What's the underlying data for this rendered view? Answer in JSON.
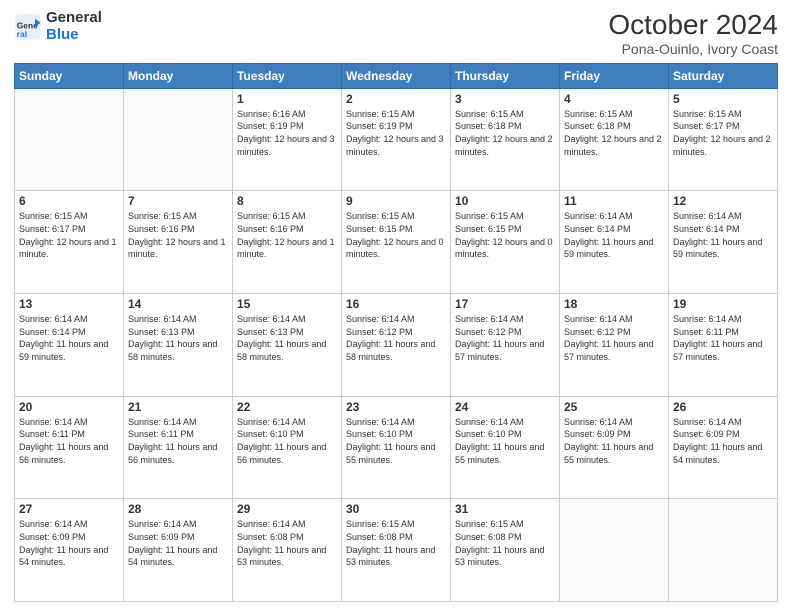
{
  "header": {
    "logo_line1": "General",
    "logo_line2": "Blue",
    "title": "October 2024",
    "subtitle": "Pona-Ouinlo, Ivory Coast"
  },
  "columns": [
    "Sunday",
    "Monday",
    "Tuesday",
    "Wednesday",
    "Thursday",
    "Friday",
    "Saturday"
  ],
  "weeks": [
    [
      {
        "day": "",
        "info": ""
      },
      {
        "day": "",
        "info": ""
      },
      {
        "day": "1",
        "info": "Sunrise: 6:16 AM\nSunset: 6:19 PM\nDaylight: 12 hours and 3 minutes."
      },
      {
        "day": "2",
        "info": "Sunrise: 6:15 AM\nSunset: 6:19 PM\nDaylight: 12 hours and 3 minutes."
      },
      {
        "day": "3",
        "info": "Sunrise: 6:15 AM\nSunset: 6:18 PM\nDaylight: 12 hours and 2 minutes."
      },
      {
        "day": "4",
        "info": "Sunrise: 6:15 AM\nSunset: 6:18 PM\nDaylight: 12 hours and 2 minutes."
      },
      {
        "day": "5",
        "info": "Sunrise: 6:15 AM\nSunset: 6:17 PM\nDaylight: 12 hours and 2 minutes."
      }
    ],
    [
      {
        "day": "6",
        "info": "Sunrise: 6:15 AM\nSunset: 6:17 PM\nDaylight: 12 hours and 1 minute."
      },
      {
        "day": "7",
        "info": "Sunrise: 6:15 AM\nSunset: 6:16 PM\nDaylight: 12 hours and 1 minute."
      },
      {
        "day": "8",
        "info": "Sunrise: 6:15 AM\nSunset: 6:16 PM\nDaylight: 12 hours and 1 minute."
      },
      {
        "day": "9",
        "info": "Sunrise: 6:15 AM\nSunset: 6:15 PM\nDaylight: 12 hours and 0 minutes."
      },
      {
        "day": "10",
        "info": "Sunrise: 6:15 AM\nSunset: 6:15 PM\nDaylight: 12 hours and 0 minutes."
      },
      {
        "day": "11",
        "info": "Sunrise: 6:14 AM\nSunset: 6:14 PM\nDaylight: 11 hours and 59 minutes."
      },
      {
        "day": "12",
        "info": "Sunrise: 6:14 AM\nSunset: 6:14 PM\nDaylight: 11 hours and 59 minutes."
      }
    ],
    [
      {
        "day": "13",
        "info": "Sunrise: 6:14 AM\nSunset: 6:14 PM\nDaylight: 11 hours and 59 minutes."
      },
      {
        "day": "14",
        "info": "Sunrise: 6:14 AM\nSunset: 6:13 PM\nDaylight: 11 hours and 58 minutes."
      },
      {
        "day": "15",
        "info": "Sunrise: 6:14 AM\nSunset: 6:13 PM\nDaylight: 11 hours and 58 minutes."
      },
      {
        "day": "16",
        "info": "Sunrise: 6:14 AM\nSunset: 6:12 PM\nDaylight: 11 hours and 58 minutes."
      },
      {
        "day": "17",
        "info": "Sunrise: 6:14 AM\nSunset: 6:12 PM\nDaylight: 11 hours and 57 minutes."
      },
      {
        "day": "18",
        "info": "Sunrise: 6:14 AM\nSunset: 6:12 PM\nDaylight: 11 hours and 57 minutes."
      },
      {
        "day": "19",
        "info": "Sunrise: 6:14 AM\nSunset: 6:11 PM\nDaylight: 11 hours and 57 minutes."
      }
    ],
    [
      {
        "day": "20",
        "info": "Sunrise: 6:14 AM\nSunset: 6:11 PM\nDaylight: 11 hours and 56 minutes."
      },
      {
        "day": "21",
        "info": "Sunrise: 6:14 AM\nSunset: 6:11 PM\nDaylight: 11 hours and 56 minutes."
      },
      {
        "day": "22",
        "info": "Sunrise: 6:14 AM\nSunset: 6:10 PM\nDaylight: 11 hours and 56 minutes."
      },
      {
        "day": "23",
        "info": "Sunrise: 6:14 AM\nSunset: 6:10 PM\nDaylight: 11 hours and 55 minutes."
      },
      {
        "day": "24",
        "info": "Sunrise: 6:14 AM\nSunset: 6:10 PM\nDaylight: 11 hours and 55 minutes."
      },
      {
        "day": "25",
        "info": "Sunrise: 6:14 AM\nSunset: 6:09 PM\nDaylight: 11 hours and 55 minutes."
      },
      {
        "day": "26",
        "info": "Sunrise: 6:14 AM\nSunset: 6:09 PM\nDaylight: 11 hours and 54 minutes."
      }
    ],
    [
      {
        "day": "27",
        "info": "Sunrise: 6:14 AM\nSunset: 6:09 PM\nDaylight: 11 hours and 54 minutes."
      },
      {
        "day": "28",
        "info": "Sunrise: 6:14 AM\nSunset: 6:09 PM\nDaylight: 11 hours and 54 minutes."
      },
      {
        "day": "29",
        "info": "Sunrise: 6:14 AM\nSunset: 6:08 PM\nDaylight: 11 hours and 53 minutes."
      },
      {
        "day": "30",
        "info": "Sunrise: 6:15 AM\nSunset: 6:08 PM\nDaylight: 11 hours and 53 minutes."
      },
      {
        "day": "31",
        "info": "Sunrise: 6:15 AM\nSunset: 6:08 PM\nDaylight: 11 hours and 53 minutes."
      },
      {
        "day": "",
        "info": ""
      },
      {
        "day": "",
        "info": ""
      }
    ]
  ]
}
